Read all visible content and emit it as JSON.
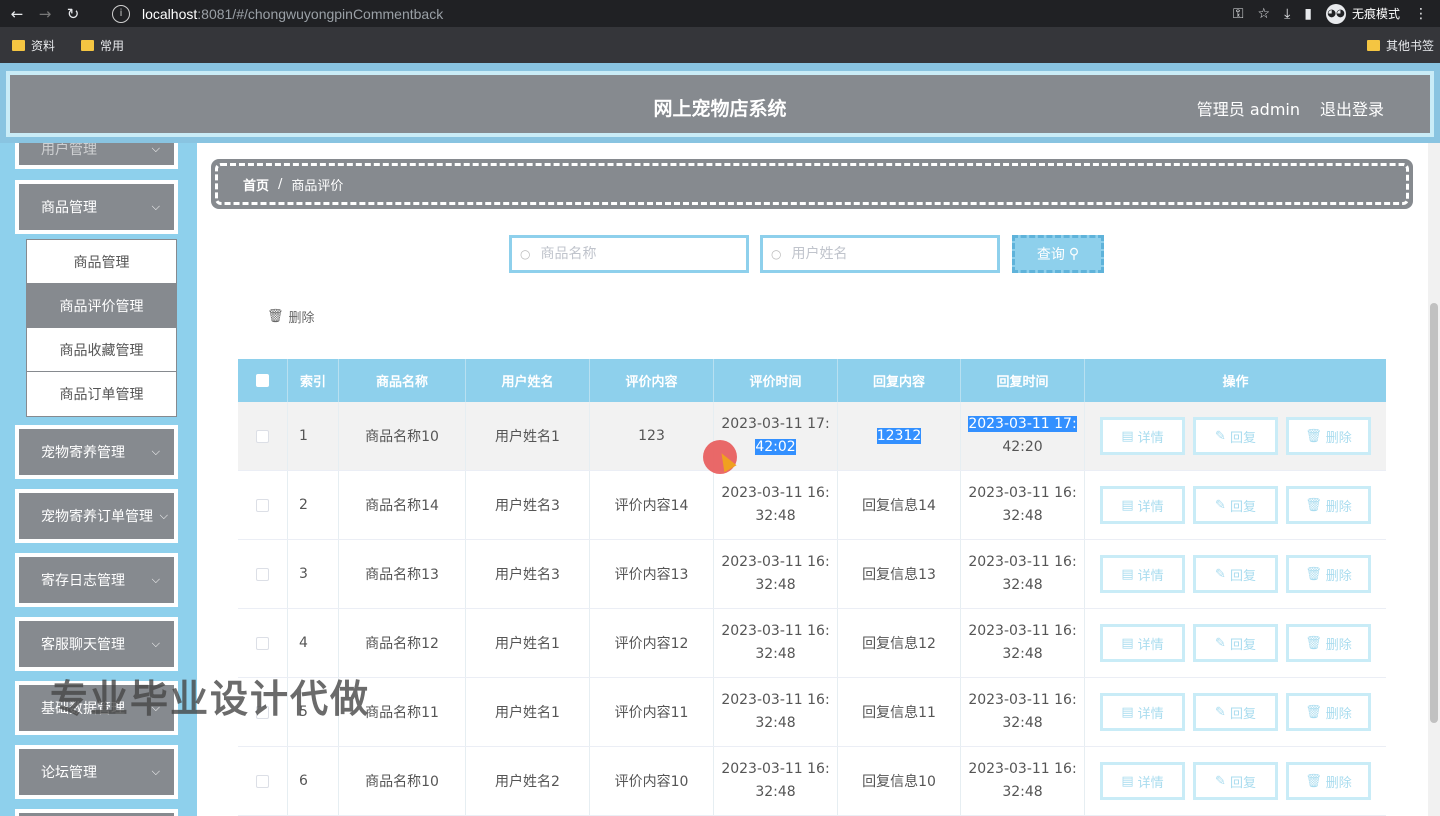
{
  "browser": {
    "url_host": "localhost",
    "url_path": ":8081/#/chongwuyongpinCommentback",
    "incognito_label": "无痕模式",
    "bookmarks": [
      "资料",
      "常用"
    ],
    "other_bookmarks": "其他书签"
  },
  "header": {
    "title": "网上宠物店系统",
    "user": "管理员 admin",
    "logout": "退出登录"
  },
  "sidebar": {
    "menus": [
      {
        "label": "用户管理"
      },
      {
        "label": "商品管理"
      },
      {
        "label": "宠物寄养管理"
      },
      {
        "label": "宠物寄养订单管理"
      },
      {
        "label": "寄存日志管理"
      },
      {
        "label": "客服聊天管理"
      },
      {
        "label": "基础数据管理"
      },
      {
        "label": "论坛管理"
      }
    ],
    "submenu": [
      "商品管理",
      "商品评价管理",
      "商品收藏管理",
      "商品订单管理"
    ]
  },
  "breadcrumb": {
    "home": "首页",
    "sep": "/",
    "current": "商品评价"
  },
  "search": {
    "product_placeholder": "商品名称",
    "user_placeholder": "用户姓名",
    "query_label": "查询"
  },
  "toolbar": {
    "delete_label": "删除"
  },
  "table": {
    "headers": [
      "索引",
      "商品名称",
      "用户姓名",
      "评价内容",
      "评价时间",
      "回复内容",
      "回复时间",
      "操作"
    ],
    "actions": {
      "detail": "详情",
      "reply": "回复",
      "delete": "删除"
    },
    "rows": [
      {
        "idx": "1",
        "product": "商品名称10",
        "user": "用户姓名1",
        "content": "123",
        "time_a": "2023-03-11 17:",
        "time_b": "42:02",
        "reply": "12312",
        "rtime_a": "2023-03-11 17:",
        "rtime_b": "42:20"
      },
      {
        "idx": "2",
        "product": "商品名称14",
        "user": "用户姓名3",
        "content": "评价内容14",
        "time_a": "2023-03-11 16:",
        "time_b": "32:48",
        "reply": "回复信息14",
        "rtime_a": "2023-03-11 16:",
        "rtime_b": "32:48"
      },
      {
        "idx": "3",
        "product": "商品名称13",
        "user": "用户姓名3",
        "content": "评价内容13",
        "time_a": "2023-03-11 16:",
        "time_b": "32:48",
        "reply": "回复信息13",
        "rtime_a": "2023-03-11 16:",
        "rtime_b": "32:48"
      },
      {
        "idx": "4",
        "product": "商品名称12",
        "user": "用户姓名1",
        "content": "评价内容12",
        "time_a": "2023-03-11 16:",
        "time_b": "32:48",
        "reply": "回复信息12",
        "rtime_a": "2023-03-11 16:",
        "rtime_b": "32:48"
      },
      {
        "idx": "5",
        "product": "商品名称11",
        "user": "用户姓名1",
        "content": "评价内容11",
        "time_a": "2023-03-11 16:",
        "time_b": "32:48",
        "reply": "回复信息11",
        "rtime_a": "2023-03-11 16:",
        "rtime_b": "32:48"
      },
      {
        "idx": "6",
        "product": "商品名称10",
        "user": "用户姓名2",
        "content": "评价内容10",
        "time_a": "2023-03-11 16:",
        "time_b": "32:48",
        "reply": "回复信息10",
        "rtime_a": "2023-03-11 16:",
        "rtime_b": "32:48"
      }
    ]
  },
  "watermark": "专业毕业设计代做",
  "colors": {
    "accent": "#8ed0ec",
    "menu_gray": "#868a8f",
    "selection": "#3390ff"
  }
}
